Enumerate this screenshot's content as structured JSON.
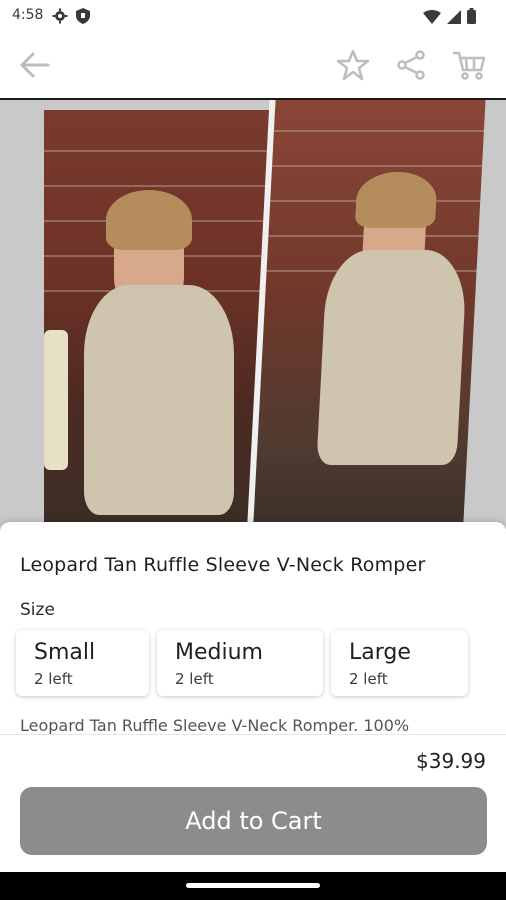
{
  "status_bar": {
    "time": "4:58",
    "icons_left": [
      "settings-icon",
      "shield-icon"
    ],
    "icons_right": [
      "wifi-icon",
      "signal-icon",
      "battery-icon"
    ]
  },
  "app_bar": {
    "icons": [
      "back-arrow-icon",
      "star-icon",
      "share-icon",
      "cart-icon"
    ]
  },
  "product": {
    "title": "Leopard Tan Ruffle Sleeve V-Neck Romper",
    "size_label": "Size",
    "sizes": [
      {
        "name": "Small",
        "stock": "2 left"
      },
      {
        "name": "Medium",
        "stock": "2 left"
      },
      {
        "name": "Large",
        "stock": "2 left"
      }
    ],
    "description_snippet": "Leopard Tan Ruffle Sleeve V-Neck Romper. 100%",
    "price": "$39.99",
    "add_to_cart_label": "Add to Cart"
  },
  "colors": {
    "button_disabled": "#8c8c8c",
    "nav_bar": "#000000"
  }
}
